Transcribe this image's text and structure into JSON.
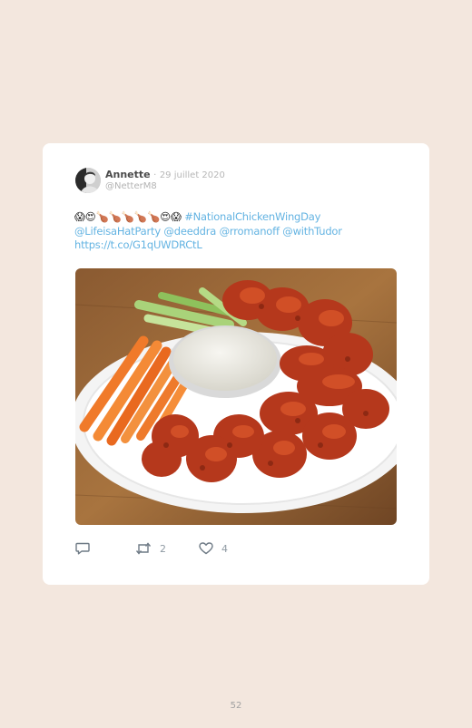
{
  "tweet": {
    "author_name": "Annette",
    "separator": "·",
    "date": "29 juillet 2020",
    "handle": "@NetterM8",
    "emoji_line": "😱😍🍗🍗🍗🍗🍗😍😱",
    "hashtag": "#NationalChickenWingDay",
    "mentions": "@LifeisaHatParty @deeddra @rromanoff @withTudor",
    "link": "https://t.co/G1qUWDRCtL",
    "retweet_count": "2",
    "like_count": "4"
  },
  "icons": {
    "reply": "reply-bubble-icon",
    "retweet": "retweet-arrows-icon",
    "like": "heart-icon"
  },
  "page": {
    "number": "52"
  }
}
